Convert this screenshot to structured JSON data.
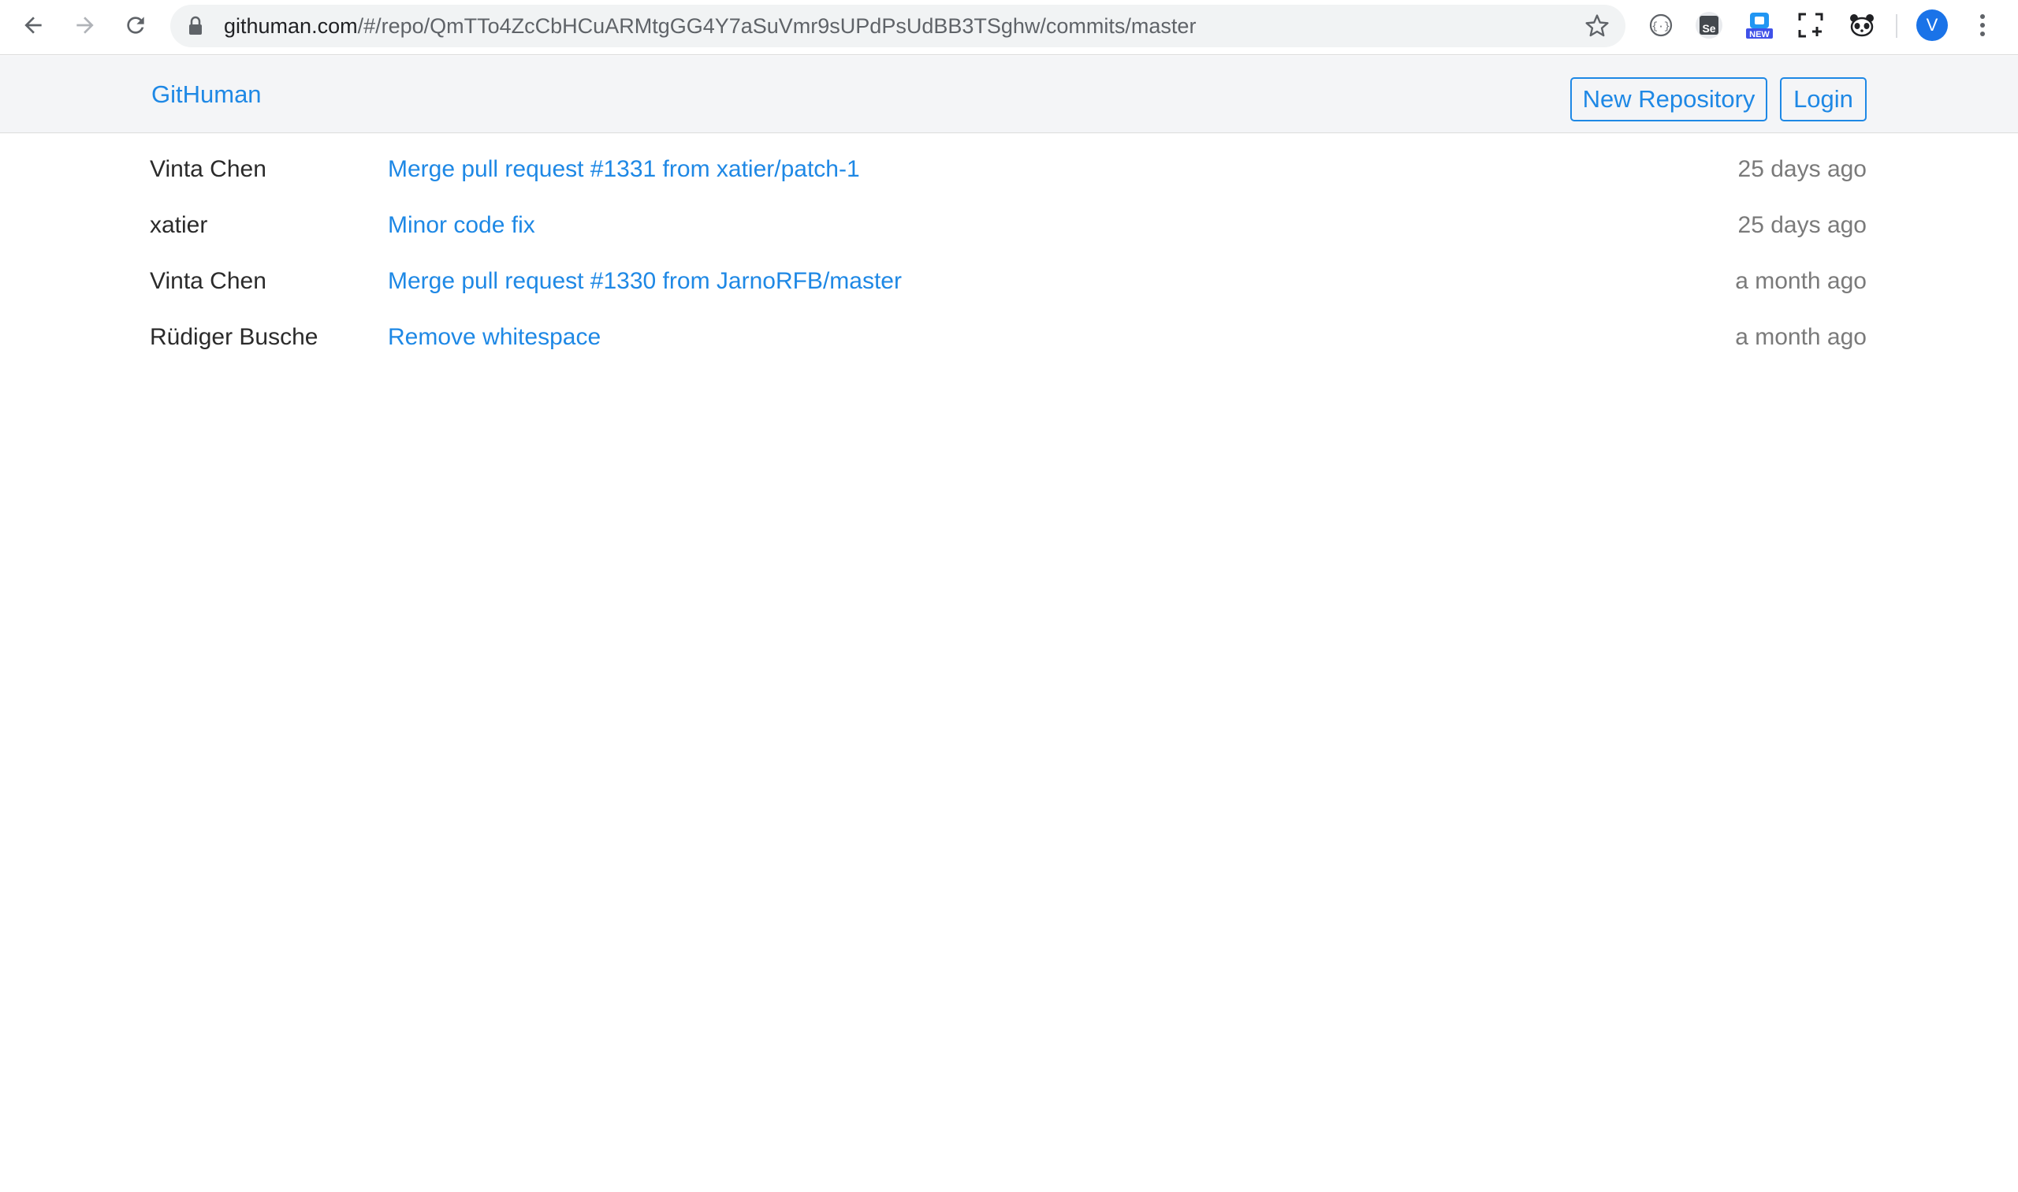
{
  "browser": {
    "url_host": "githuman.com",
    "url_path": "/#/repo/QmTTo4ZcCbHCuARMtgGG4Y7aSuVmr9sUPdPsUdBB3TSghw/commits/master",
    "profile_initial": "V",
    "extension_icons": [
      "json-viewer-icon",
      "selenium-ide-icon",
      "new-extension-icon",
      "screen-capture-icon",
      "panda-icon"
    ],
    "extension_badge": "NEW",
    "extension_se_label": "Se"
  },
  "header": {
    "brand": "GitHuman",
    "new_repository_label": "New Repository",
    "login_label": "Login"
  },
  "commits": [
    {
      "author": "Vinta Chen",
      "message": "Merge pull request #1331 from xatier/patch-1",
      "time": "25 days ago"
    },
    {
      "author": "xatier",
      "message": "Minor code fix",
      "time": "25 days ago"
    },
    {
      "author": "Vinta Chen",
      "message": "Merge pull request #1330 from JarnoRFB/master",
      "time": "a month ago"
    },
    {
      "author": "Rüdiger Busche",
      "message": "Remove whitespace",
      "time": "a month ago"
    }
  ],
  "colors": {
    "link_blue": "#1e88e5",
    "header_bg": "#f4f5f7",
    "author_text": "#2b2b2b",
    "time_text": "#7a7a7a"
  }
}
